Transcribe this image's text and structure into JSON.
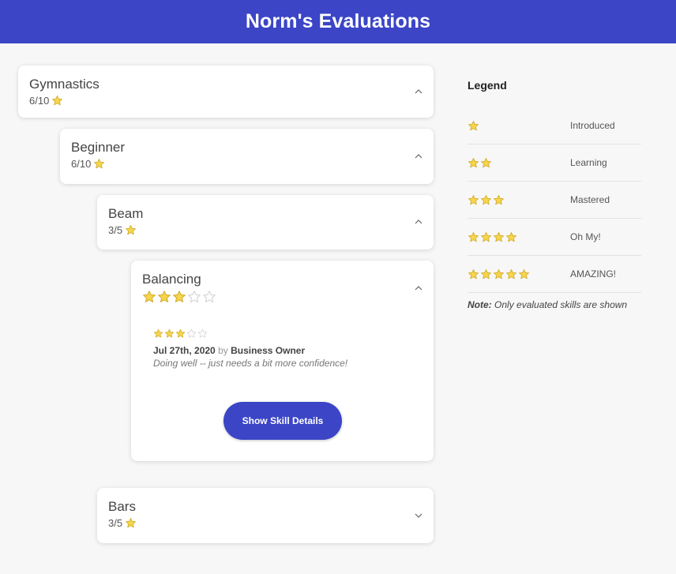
{
  "header": {
    "title": "Norm's Evaluations"
  },
  "colors": {
    "brand": "#3b45c6",
    "star_fill": "#f5d54a",
    "star_stroke": "#d1a92a",
    "star_empty": "#cfcfcf"
  },
  "cards": {
    "gymnastics": {
      "title": "Gymnastics",
      "score": "6/10",
      "chevron": "chevron-up-icon"
    },
    "beginner": {
      "title": "Beginner",
      "score": "6/10",
      "chevron": "chevron-up-icon"
    },
    "beam": {
      "title": "Beam",
      "score": "3/5",
      "chevron": "chevron-up-icon"
    },
    "balancing": {
      "title": "Balancing",
      "rating": 3,
      "rating_max": 5,
      "chevron": "chevron-up-icon",
      "evaluation": {
        "rating": 3,
        "rating_max": 5,
        "date": "Jul 27th, 2020",
        "by": "by",
        "evaluator": "Business Owner",
        "comment": "Doing well -- just needs a bit more confidence!"
      },
      "button_label": "Show Skill Details"
    },
    "bars": {
      "title": "Bars",
      "score": "3/5",
      "chevron": "chevron-down-icon"
    }
  },
  "legend": {
    "title": "Legend",
    "rows": [
      {
        "stars": 1,
        "label": "Introduced"
      },
      {
        "stars": 2,
        "label": "Learning"
      },
      {
        "stars": 3,
        "label": "Mastered"
      },
      {
        "stars": 4,
        "label": "Oh My!"
      },
      {
        "stars": 5,
        "label": "AMAZING!"
      }
    ],
    "note_label": "Note:",
    "note_text": "Only evaluated skills are shown"
  }
}
